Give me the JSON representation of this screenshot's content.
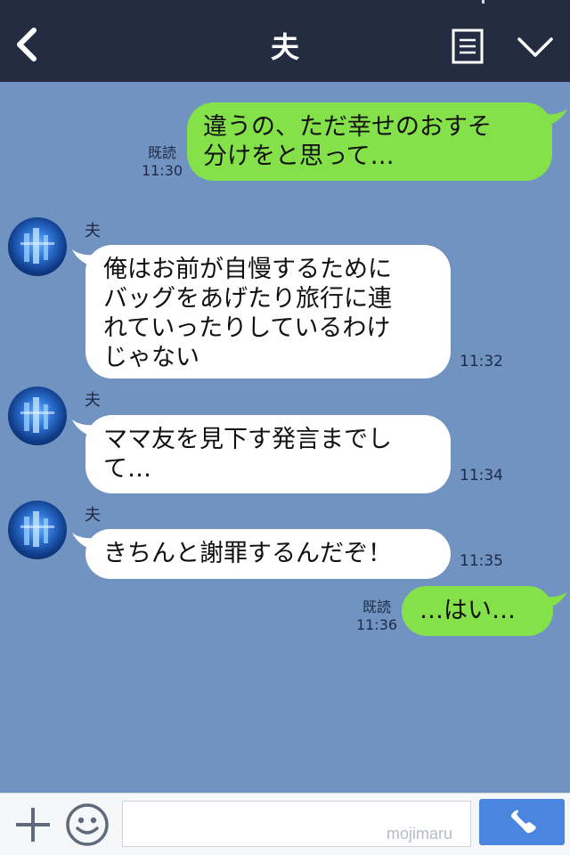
{
  "header": {
    "title": "夫",
    "back_icon": "chevron-left-icon",
    "menu_icon": "list-icon",
    "collapse_icon": "chevron-down-icon"
  },
  "messages": [
    {
      "from": "me",
      "text": "違うの、ただ幸せのおすそ\n分けをと思って…",
      "read_label": "既読",
      "time": "11:30"
    },
    {
      "from": "them",
      "sender": "夫",
      "text": "俺はお前が自慢するために\nバッグをあげたり旅行に連\nれていったりしているわけ\nじゃない",
      "time": "11:32"
    },
    {
      "from": "them",
      "sender": "夫",
      "text": "ママ友を見下す発言までし\nて…",
      "time": "11:34"
    },
    {
      "from": "them",
      "sender": "夫",
      "text": "きちんと謝罪するんだぞ！",
      "time": "11:35"
    },
    {
      "from": "me",
      "text": "…はい…",
      "read_label": "既読",
      "time": "11:36"
    }
  ],
  "input_bar": {
    "plus_icon": "plus-icon",
    "sticker_icon": "smiley-icon",
    "placeholder": "",
    "watermark": "mojimaru",
    "call_icon": "phone-icon"
  },
  "colors": {
    "header_bg": "#232c40",
    "chat_bg": "#7193c2",
    "my_bubble": "#84e14a",
    "their_bubble": "#ffffff",
    "call_button": "#4a85e0"
  }
}
